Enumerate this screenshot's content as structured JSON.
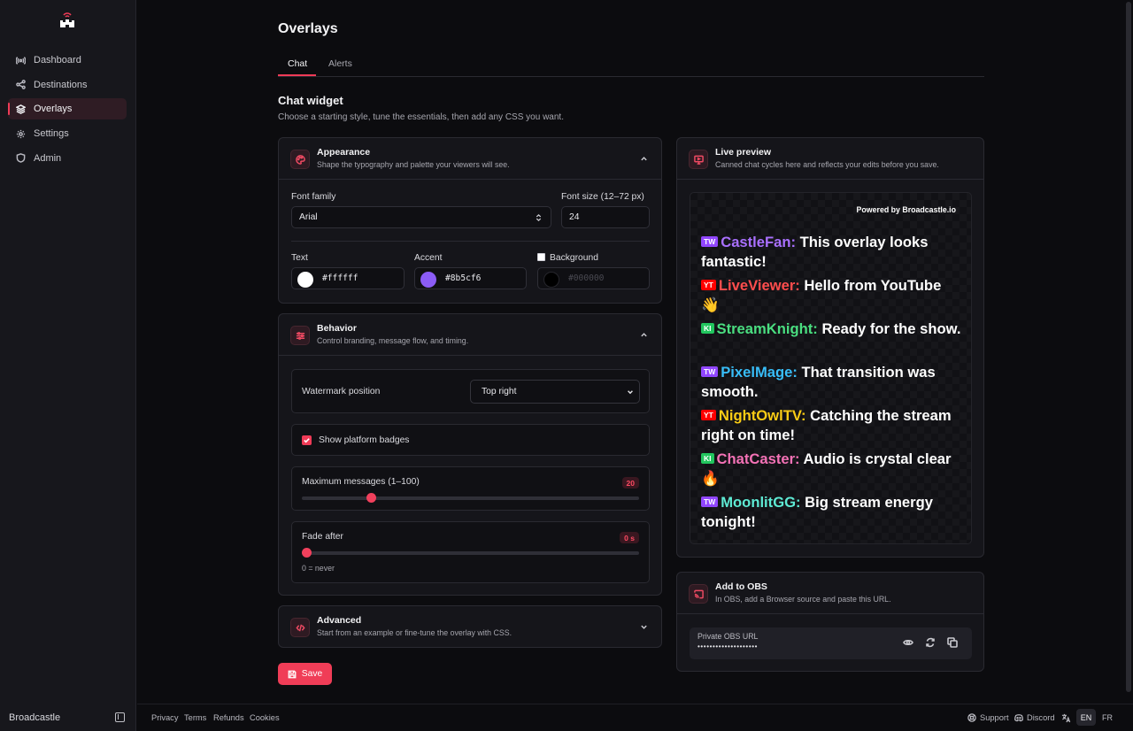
{
  "brand": "Broadcastle",
  "sidebar": {
    "items": [
      {
        "label": "Dashboard",
        "icon": "radio-icon"
      },
      {
        "label": "Destinations",
        "icon": "share-icon"
      },
      {
        "label": "Overlays",
        "icon": "layers-icon",
        "active": true
      },
      {
        "label": "Settings",
        "icon": "gear-icon"
      },
      {
        "label": "Admin",
        "icon": "shield-icon"
      }
    ]
  },
  "page": {
    "title": "Overlays",
    "tabs": [
      {
        "label": "Chat",
        "active": true
      },
      {
        "label": "Alerts"
      }
    ],
    "section_title": "Chat widget",
    "section_subtitle": "Choose a starting style, tune the essentials, then add any CSS you want."
  },
  "appearance": {
    "title": "Appearance",
    "desc": "Shape the typography and palette your viewers will see.",
    "font_family_label": "Font family",
    "font_family_value": "Arial",
    "font_size_label": "Font size (12–72 px)",
    "font_size_value": "24",
    "text_label": "Text",
    "text_value": "#ffffff",
    "accent_label": "Accent",
    "accent_value": "#8b5cf6",
    "background_label": "Background",
    "background_value": "#000000"
  },
  "behavior": {
    "title": "Behavior",
    "desc": "Control branding, message flow, and timing.",
    "watermark_label": "Watermark position",
    "watermark_value": "Top right",
    "badges_label": "Show platform badges",
    "badges_checked": true,
    "max_messages_label": "Maximum messages (1–100)",
    "max_messages_value": "20",
    "max_messages_min": 1,
    "max_messages_max": 100,
    "fade_label": "Fade after",
    "fade_value": "0 s",
    "fade_fraction": 0,
    "fade_hint": "0 = never"
  },
  "advanced": {
    "title": "Advanced",
    "desc": "Start from an example or fine-tune the overlay with CSS."
  },
  "save_label": "Save",
  "preview": {
    "title": "Live preview",
    "desc": "Canned chat cycles here and reflects your edits before you save.",
    "powered": "Powered by Broadcastle.io",
    "messages": [
      {
        "badge": "TW",
        "badge_color": "#9146ff",
        "user": "CastleFan:",
        "user_color": "#a970ff",
        "text": "This overlay looks fantastic!"
      },
      {
        "badge": "YT",
        "badge_color": "#ff0000",
        "user": "LiveViewer:",
        "user_color": "#ff4d4d",
        "text": "Hello from YouTube 👋"
      },
      {
        "badge": "KI",
        "badge_color": "#22c55e",
        "user": "StreamKnight:",
        "user_color": "#4ade80",
        "text": "Ready for the show."
      },
      {
        "badge": "TW",
        "badge_color": "#9146ff",
        "user": "PixelMage:",
        "user_color": "#38bdf8",
        "text": "That transition was smooth."
      },
      {
        "badge": "YT",
        "badge_color": "#ff0000",
        "user": "NightOwlTV:",
        "user_color": "#facc15",
        "text": "Catching the stream right on time!"
      },
      {
        "badge": "KI",
        "badge_color": "#22c55e",
        "user": "ChatCaster:",
        "user_color": "#f472b6",
        "text": "Audio is crystal clear 🔥"
      },
      {
        "badge": "TW",
        "badge_color": "#9146ff",
        "user": "MoonlitGG:",
        "user_color": "#5eead4",
        "text": "Big stream energy tonight!"
      }
    ]
  },
  "obs": {
    "title": "Add to OBS",
    "desc": "In OBS, add a Browser source and paste this URL.",
    "url_label": "Private OBS URL",
    "url_masked": "••••••••••••••••••••"
  },
  "footer": {
    "links": [
      "Privacy",
      "Terms",
      "Refunds",
      "Cookies"
    ],
    "support": "Support",
    "discord": "Discord",
    "langs": [
      "EN",
      "FR"
    ],
    "active_lang": "EN"
  },
  "colors": {
    "accent": "#f03d57",
    "background": "#0c0c0f",
    "panel": "#15151a"
  }
}
